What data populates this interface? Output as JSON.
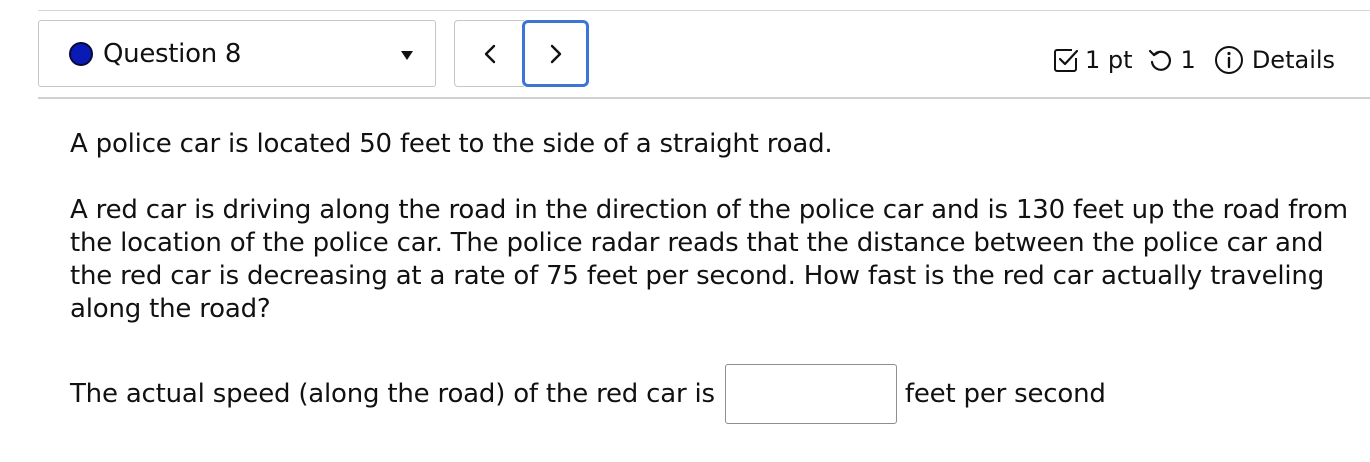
{
  "header": {
    "question_label": "Question 8",
    "prev_icon": "chevron-left",
    "next_icon": "chevron-right",
    "points": "1 pt",
    "attempts": "1",
    "details_label": "Details",
    "status_color": "#0a1ab4",
    "focus_color": "#3b75d6"
  },
  "question": {
    "paragraph1": "A police car is located 50 feet to the side of a straight road.",
    "paragraph2": "A red car is driving along the road in the direction of the police car and is 130 feet up the road from the location of the police car. The police radar reads that the distance between the police car and the red car is decreasing at a rate of 75 feet per second. How fast is the red car actually traveling along the road?"
  },
  "answer": {
    "prompt": "The actual speed (along the road) of the red car is",
    "value": "",
    "placeholder": "",
    "unit": "feet per second"
  }
}
